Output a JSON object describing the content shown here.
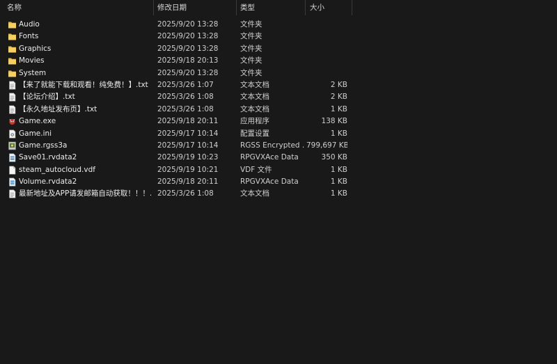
{
  "header": {
    "name_label": "名称",
    "date_label": "修改日期",
    "type_label": "类型",
    "size_label": "大小",
    "sort_indicator": "^"
  },
  "rows": [
    {
      "icon": "folder-icon",
      "name": "Audio",
      "date": "2025/9/20 13:28",
      "type": "文件夹",
      "size": ""
    },
    {
      "icon": "folder-icon",
      "name": "Fonts",
      "date": "2025/9/20 13:28",
      "type": "文件夹",
      "size": ""
    },
    {
      "icon": "folder-icon",
      "name": "Graphics",
      "date": "2025/9/20 13:28",
      "type": "文件夹",
      "size": ""
    },
    {
      "icon": "folder-icon",
      "name": "Movies",
      "date": "2025/9/18 20:13",
      "type": "文件夹",
      "size": ""
    },
    {
      "icon": "folder-icon",
      "name": "System",
      "date": "2025/9/20 13:28",
      "type": "文件夹",
      "size": ""
    },
    {
      "icon": "text-file-icon",
      "name": "【来了就能下载和观看！纯免费！】.txt",
      "date": "2025/3/26 1:07",
      "type": "文本文档",
      "size": "2 KB"
    },
    {
      "icon": "text-file-icon",
      "name": "【论坛介绍】.txt",
      "date": "2025/3/26 1:08",
      "type": "文本文档",
      "size": "2 KB"
    },
    {
      "icon": "text-file-icon",
      "name": "【永久地址发布页】.txt",
      "date": "2025/3/26 1:08",
      "type": "文本文档",
      "size": "1 KB"
    },
    {
      "icon": "game-exe-icon",
      "name": "Game.exe",
      "date": "2025/9/18 20:11",
      "type": "应用程序",
      "size": "138 KB"
    },
    {
      "icon": "ini-file-icon",
      "name": "Game.ini",
      "date": "2025/9/17 10:14",
      "type": "配置设置",
      "size": "1 KB"
    },
    {
      "icon": "rgss-file-icon",
      "name": "Game.rgss3a",
      "date": "2025/9/17 10:14",
      "type": "RGSS Encrypted ...",
      "size": "799,697 KB"
    },
    {
      "icon": "data-file-icon",
      "name": "Save01.rvdata2",
      "date": "2025/9/19 10:23",
      "type": "RPGVXAce Data",
      "size": "350 KB"
    },
    {
      "icon": "blank-file-icon",
      "name": "steam_autocloud.vdf",
      "date": "2025/9/19 10:21",
      "type": "VDF 文件",
      "size": "1 KB"
    },
    {
      "icon": "data-file-icon",
      "name": "Volume.rvdata2",
      "date": "2025/9/18 20:11",
      "type": "RPGVXAce Data",
      "size": "1 KB"
    },
    {
      "icon": "text-file-icon",
      "name": "最新地址及APP请发邮箱自动获取！！！....",
      "date": "2025/3/26 1:08",
      "type": "文本文档",
      "size": "1 KB"
    }
  ]
}
